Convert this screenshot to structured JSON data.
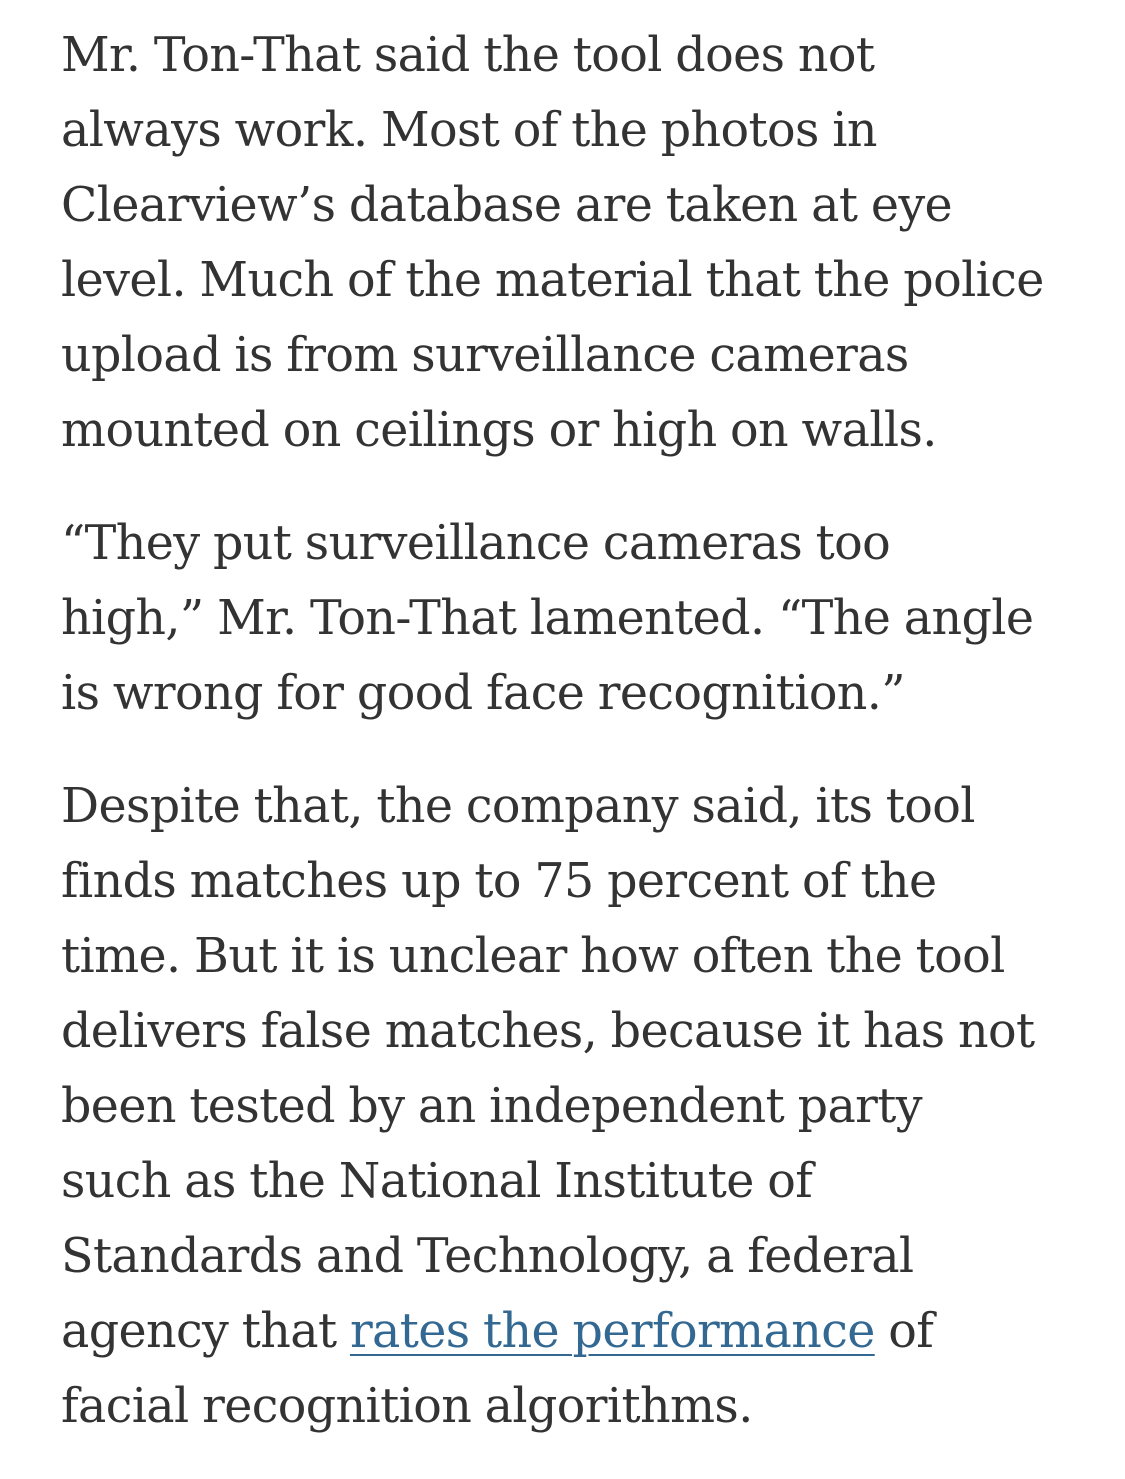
{
  "article": {
    "paragraphs": [
      {
        "lines": [
          "Mr. Ton-That said the tool does not",
          "always work. Most of the photos in",
          "Clearview’s database are taken at eye",
          "level. Much of the material that the police",
          "upload is from surveillance cameras",
          "mounted on ceilings or high on walls."
        ]
      },
      {
        "lines": [
          "“They put surveillance cameras too",
          "high,” Mr. Ton-That lamented. “The angle",
          "is wrong for good face recognition.”"
        ]
      },
      {
        "lines": [
          "Despite that, the company said, its tool",
          "finds matches up to 75 percent of the",
          "time. But it is unclear how often the tool",
          "delivers false matches, because it has not",
          "been tested by an independent party",
          "such as the National Institute of",
          "Standards and Technology, a federal"
        ],
        "link_line": {
          "before": "agency that ",
          "link_text": "rates the performance",
          "after": " of"
        },
        "last_line": "facial recognition algorithms."
      }
    ]
  },
  "colors": {
    "text": "#333333",
    "link": "#326891",
    "background": "#ffffff"
  }
}
